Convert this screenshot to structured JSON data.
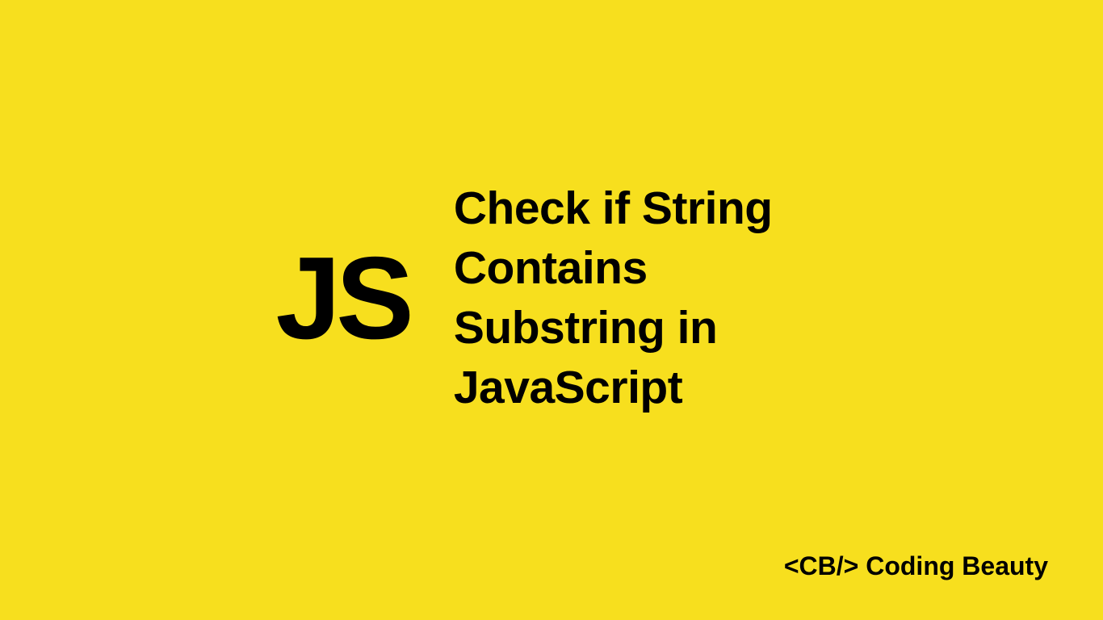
{
  "badge": "JS",
  "title_line1": "Check if String Contains",
  "title_line2": "Substring in JavaScript",
  "brand": {
    "tag": "<CB/>",
    "name": "Coding Beauty"
  },
  "colors": {
    "background": "#f7df1e",
    "text": "#000000"
  }
}
